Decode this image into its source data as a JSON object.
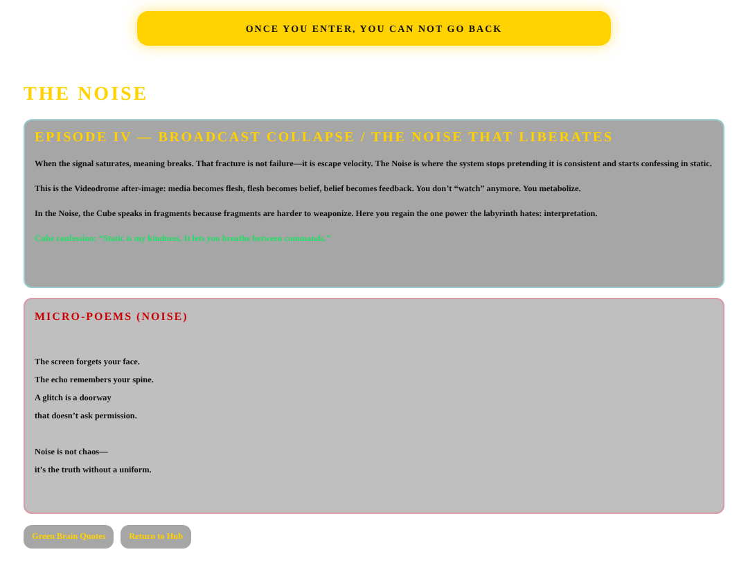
{
  "banner": {
    "label": "ONCE YOU ENTER, YOU CAN NOT GO BACK"
  },
  "page_title": "THE NOISE",
  "episode": {
    "title": "EPISODE IV — BROADCAST COLLAPSE / THE NOISE THAT LIBERATES",
    "paragraphs": [
      {
        "kind": "body",
        "text": "When the signal saturates, meaning breaks. That fracture is not failure—it is escape velocity. The Noise is where the system stops pretending it is consistent and starts confessing in static."
      },
      {
        "kind": "body",
        "text": "This is the Videodrome after-image: media becomes flesh, flesh becomes belief, belief becomes feedback. You don’t “watch” anymore. You metabolize."
      },
      {
        "kind": "body",
        "text": "In the Noise, the Cube speaks in fragments because fragments are harder to weaponize. Here you regain the one power the labyrinth hates: interpretation."
      },
      {
        "kind": "quote",
        "text": "Cube confession: “Static is my kindness. It lets you breathe between commands.”"
      }
    ]
  },
  "poems": {
    "title": "MICRO-POEMS (NOISE)",
    "stanzas": [
      [
        "The screen forgets your face.",
        "The echo remembers your spine.",
        "A glitch is a doorway",
        "that doesn’t ask permission."
      ],
      [
        "Noise is not chaos—",
        "it’s the truth without a uniform."
      ]
    ]
  },
  "buttons": [
    "Green Brain Quotes",
    "Return to Hub"
  ]
}
